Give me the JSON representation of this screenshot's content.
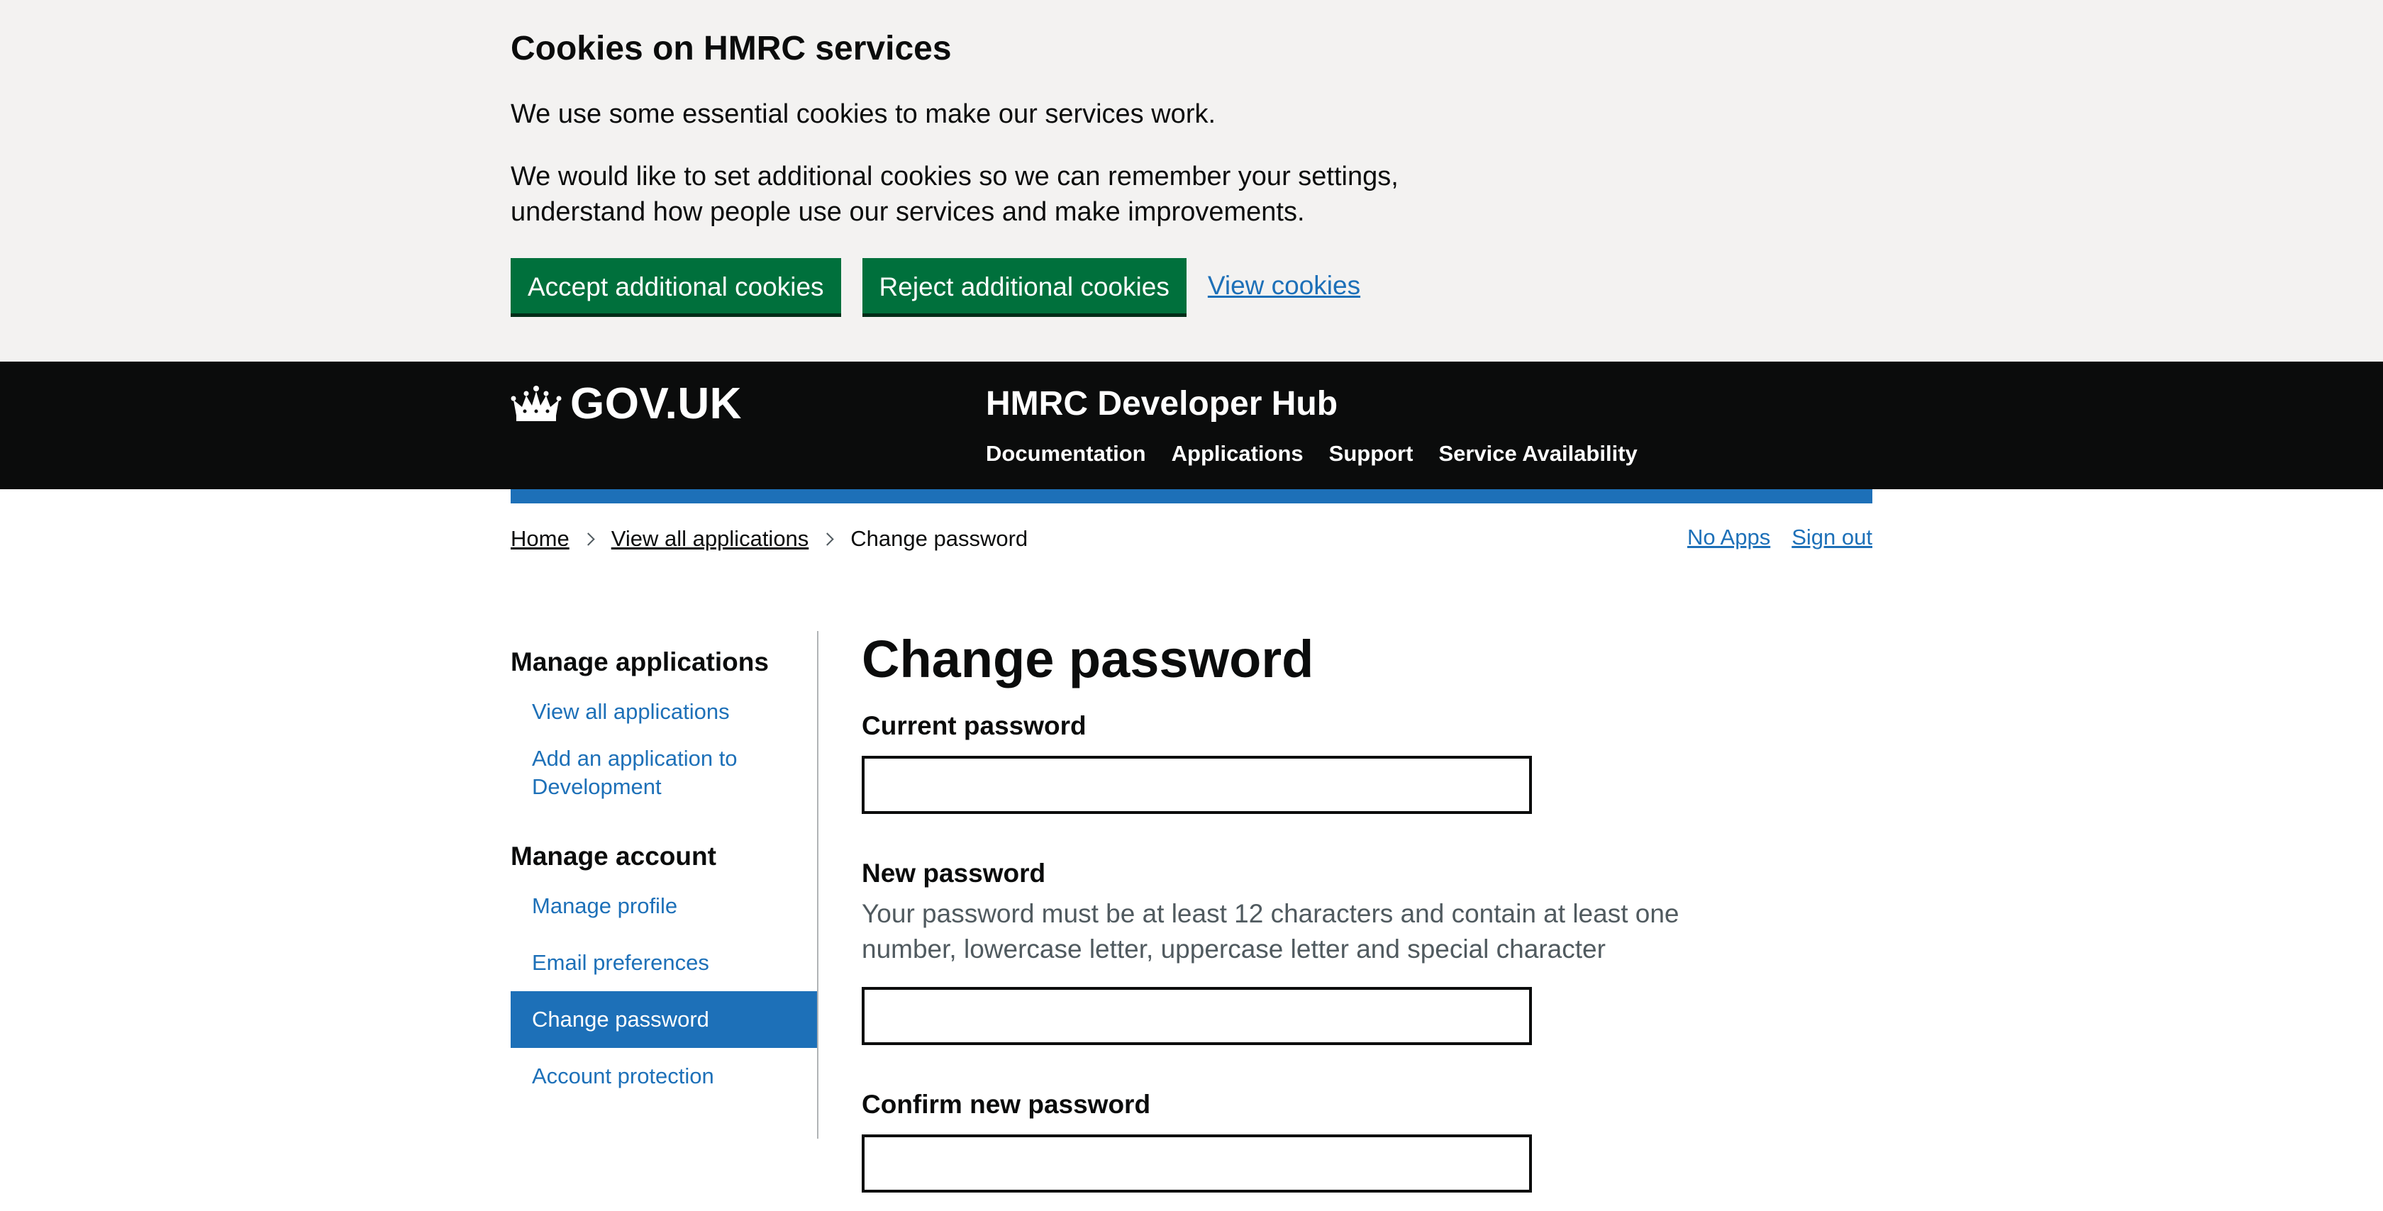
{
  "cookie_banner": {
    "title": "Cookies on HMRC services",
    "text1": "We use some essential cookies to make our services work.",
    "text2": "We would like to set additional cookies so we can remember your settings, understand how people use our services and make improvements.",
    "accept_label": "Accept additional cookies",
    "reject_label": "Reject additional cookies",
    "view_label": "View cookies"
  },
  "header": {
    "logo_text": "GOV.UK",
    "service_name": "HMRC Developer Hub",
    "nav": [
      "Documentation",
      "Applications",
      "Support",
      "Service Availability"
    ]
  },
  "breadcrumb": {
    "home": "Home",
    "applications": "View all applications",
    "current": "Change password"
  },
  "user_links": {
    "no_apps": "No Apps",
    "sign_out": "Sign out"
  },
  "side_nav": {
    "manage_applications_heading": "Manage applications",
    "applications_items": [
      "View all applications",
      "Add an application to Development"
    ],
    "manage_account_heading": "Manage account",
    "account_items": [
      "Manage profile",
      "Email preferences",
      "Change password",
      "Account protection"
    ]
  },
  "main": {
    "title": "Change password",
    "current_password_label": "Current password",
    "new_password_label": "New password",
    "new_password_hint": "Your password must be at least 12 characters and contain at least one number, lowercase letter, uppercase letter and special character",
    "confirm_password_label": "Confirm new password"
  },
  "colors": {
    "green_button": "#00703c",
    "link_blue": "#1d70b8",
    "header_black": "#0b0c0c",
    "banner_grey": "#f3f2f1"
  },
  "icons": {
    "logo": "crown-icon",
    "breadcrumb_separator": "chevron-right-icon"
  }
}
